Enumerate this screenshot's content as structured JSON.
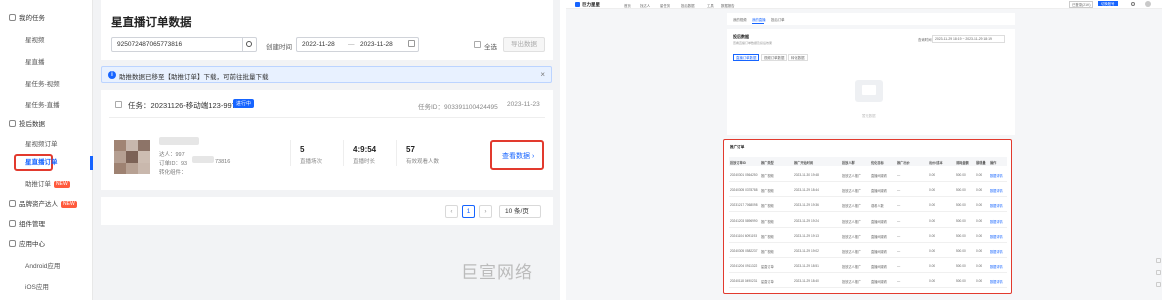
{
  "left_app": {
    "sidebar": {
      "groups": [
        {
          "label": "我的任务",
          "icon": "task-icon",
          "children": [
            "星视频",
            "星直播",
            "星任务-视频",
            "星任务-直播"
          ]
        },
        {
          "label": "投后数据",
          "icon": "chart-icon",
          "children": [
            "星视频订单",
            "星直播订单",
            "助推订单"
          ]
        },
        {
          "label": "品牌资产达人",
          "icon": "asset-icon",
          "new_badge": "NEW"
        },
        {
          "label": "组件管理",
          "icon": "component-icon"
        },
        {
          "label": "应用中心",
          "icon": "app-icon",
          "children": [
            "Android应用",
            "iOS应用"
          ]
        }
      ],
      "active_item": "星直播订单",
      "boost_badge": "NEW"
    },
    "page_title": "星直播订单数据",
    "search": {
      "value": "925072487065773816"
    },
    "date_filter": {
      "label": "创建时间",
      "start": "2022-11-28",
      "sep": "—",
      "end": "2023-11-28"
    },
    "select_all_label": "全选",
    "export_label": "导出数据",
    "banner": {
      "text": "助推数据已移至【助推订单】下载，可前往批量下载",
      "close": "×"
    },
    "task": {
      "title": "任务：20231126-移动端123-997",
      "status": "进行中",
      "task_id": "任务ID：903391100424495",
      "date": "2023-11-23",
      "talent_line": "达人：997",
      "order_line": "订单ID：93",
      "order_suffix": "73816",
      "product_line": "转化组件：",
      "stats": [
        {
          "value": "5",
          "label": "直播场次"
        },
        {
          "value": "4:9:54",
          "label": "直播时长"
        },
        {
          "value": "57",
          "label": "有效观看人数"
        }
      ],
      "view_data": "查看数据 ›"
    },
    "pagination": {
      "prev": "‹",
      "current": "1",
      "next": "›",
      "page_size": "10 条/页"
    },
    "thumb_colors": [
      "#a08474",
      "#c7b7ad",
      "#8d7468",
      "#b59f92",
      "#7c6256",
      "#cdbdb2",
      "#9e8272",
      "#b7a193",
      "#c9b8ad"
    ]
  },
  "watermark": "巨宣网络",
  "right_app": {
    "brand": "巨力星星",
    "nav": [
      "首页",
      "找达人",
      "星任务",
      "投后数据",
      "工具",
      "数据报告"
    ],
    "top_actions": [
      "已登录(21K)",
      "切换账号"
    ],
    "tabs": [
      "我的视频",
      "我的直播",
      "投后订单"
    ],
    "panel_title": "投后数据",
    "panel_subtitle": "查看直播订单数据及投后效果",
    "panel_date_label": "查询时间",
    "panel_date_value": "2023-11-29 18:19 ~ 2023-11-29 18:19",
    "sub_tabs": [
      "直播订单数据",
      "视频订单数据",
      "转化数据"
    ],
    "empty_text": "暂无数据",
    "table_title": "推广订单",
    "columns": [
      "投放订单ID",
      "推广类型",
      "推广开始时间",
      "投放人群",
      "优化目标",
      "推广出价",
      "出价/成本",
      "消耗金额",
      "展现量",
      "操作"
    ],
    "rows": [
      [
        "20240301 0564250",
        "推广视频",
        "2023-11-30 19:48",
        "投放达人推广",
        "直播间观看",
        "—",
        "0.00",
        "500.00",
        "0.00",
        "数据详情"
      ],
      [
        "20240305 0378788",
        "推广视频",
        "2023-11-29 18:44",
        "投放达人推广",
        "直播间观看",
        "—",
        "0.00",
        "500.00",
        "0.00",
        "数据详情"
      ],
      [
        "20231217 7068098",
        "推广视频",
        "2023-11-29 19:36",
        "投放达人推广",
        "观看人数",
        "—",
        "0.00",
        "500.00",
        "0.00",
        "数据详情"
      ],
      [
        "20241203 5896990",
        "推广视频",
        "2023-11-29 19:24",
        "投放达人推广",
        "直播间观看",
        "—",
        "0.00",
        "500.00",
        "0.00",
        "数据详情"
      ],
      [
        "20241104 6091193",
        "推广视频",
        "2023-11-29 19:13",
        "投放达人推广",
        "直播间观看",
        "—",
        "0.00",
        "500.00",
        "0.00",
        "数据详情"
      ],
      [
        "20240305 0582237",
        "推广视频",
        "2023-11-29 19:02",
        "投放达人推广",
        "直播间观看",
        "—",
        "0.00",
        "500.00",
        "0.00",
        "数据详情"
      ],
      [
        "20241204 0911322",
        "星直订单",
        "2023-11-29 18:51",
        "投放达人推广",
        "直播间观看",
        "—",
        "0.00",
        "500.00",
        "0.00",
        "数据详情"
      ],
      [
        "20240118 0490231",
        "星直订单",
        "2023-11-29 18:40",
        "投放达人推广",
        "直播间观看",
        "—",
        "0.00",
        "500.00",
        "0.00",
        "数据详情"
      ]
    ],
    "accent": "#1664ff"
  },
  "colors": {
    "accent": "#1664ff",
    "highlight_border": "#e23a2e",
    "new_badge": "#ff5a3c"
  }
}
